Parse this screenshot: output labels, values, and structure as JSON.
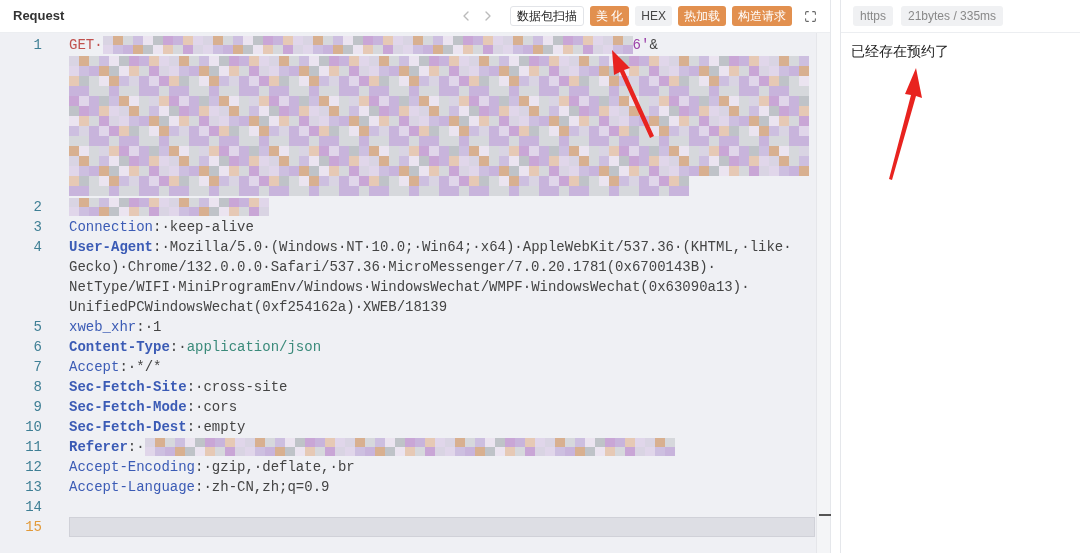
{
  "request": {
    "title": "Request",
    "toolbar": [
      {
        "label": "数据包扫描",
        "kind": "outline"
      },
      {
        "label": "美 化",
        "kind": "accent"
      },
      {
        "label": "HEX",
        "kind": "muted"
      },
      {
        "label": "热加载",
        "kind": "accent"
      },
      {
        "label": "构造请求",
        "kind": "accent"
      }
    ],
    "lines": [
      {
        "number": "1",
        "current": false,
        "segments": [
          {
            "kind": "method",
            "text": "GET·"
          },
          {
            "kind": "redacted-inline"
          },
          {
            "kind": "string",
            "text": "6'"
          },
          {
            "kind": "plain",
            "text": "&"
          },
          {
            "kind": "redacted-block"
          }
        ]
      },
      {
        "number": "2",
        "current": false,
        "segments": [
          {
            "kind": "redacted-short"
          }
        ]
      },
      {
        "number": "3",
        "current": false,
        "segments": [
          {
            "kind": "key",
            "bold": false,
            "text": "Connection"
          },
          {
            "kind": "plain",
            "text": ":·keep-alive"
          }
        ]
      },
      {
        "number": "4",
        "current": false,
        "segments": [
          {
            "kind": "key",
            "bold": true,
            "text": "User-Agent"
          },
          {
            "kind": "plain",
            "text": ":·Mozilla/5.0·(Windows·NT·10.0;·Win64;·x64)·AppleWebKit/537.36·(KHTML,·like·Gecko)·Chrome/132.0.0.0·Safari/537.36·MicroMessenger/7.0.20.1781(0x6700143B)·NetType/WIFI·MiniProgramEnv/Windows·WindowsWechat/WMPF·WindowsWechat(0x63090a13)·UnifiedPCWindowsWechat(0xf254162a)·XWEB/18139"
          }
        ]
      },
      {
        "number": "5",
        "current": false,
        "segments": [
          {
            "kind": "key",
            "bold": false,
            "text": "xweb_xhr"
          },
          {
            "kind": "plain",
            "text": ":·1"
          }
        ]
      },
      {
        "number": "6",
        "current": false,
        "segments": [
          {
            "kind": "key",
            "bold": true,
            "text": "Content-Type"
          },
          {
            "kind": "plain",
            "text": ":·"
          },
          {
            "kind": "value",
            "text": "application/json"
          }
        ]
      },
      {
        "number": "7",
        "current": false,
        "segments": [
          {
            "kind": "key",
            "bold": false,
            "text": "Accept"
          },
          {
            "kind": "plain",
            "text": ":·*/*"
          }
        ]
      },
      {
        "number": "8",
        "current": false,
        "segments": [
          {
            "kind": "key",
            "bold": true,
            "text": "Sec-Fetch-Site"
          },
          {
            "kind": "plain",
            "text": ":·cross-site"
          }
        ]
      },
      {
        "number": "9",
        "current": false,
        "segments": [
          {
            "kind": "key",
            "bold": true,
            "text": "Sec-Fetch-Mode"
          },
          {
            "kind": "plain",
            "text": ":·cors"
          }
        ]
      },
      {
        "number": "10",
        "current": false,
        "segments": [
          {
            "kind": "key",
            "bold": true,
            "text": "Sec-Fetch-Dest"
          },
          {
            "kind": "plain",
            "text": ":·empty"
          }
        ]
      },
      {
        "number": "11",
        "current": false,
        "segments": [
          {
            "kind": "key",
            "bold": true,
            "text": "Referer"
          },
          {
            "kind": "plain",
            "text": ":·"
          },
          {
            "kind": "redacted-inline"
          }
        ]
      },
      {
        "number": "12",
        "current": false,
        "segments": [
          {
            "kind": "key",
            "bold": false,
            "text": "Accept-Encoding"
          },
          {
            "kind": "plain",
            "text": ":·gzip,·deflate,·br"
          }
        ]
      },
      {
        "number": "13",
        "current": false,
        "segments": [
          {
            "kind": "key",
            "bold": false,
            "text": "Accept-Language"
          },
          {
            "kind": "plain",
            "text": ":·zh-CN,zh;q=0.9"
          }
        ]
      },
      {
        "number": "14",
        "current": false
      },
      {
        "number": "15",
        "current": true
      }
    ]
  },
  "response": {
    "tags": [
      "https",
      "21bytes / 335ms"
    ],
    "body": "已经存在预约了"
  }
}
